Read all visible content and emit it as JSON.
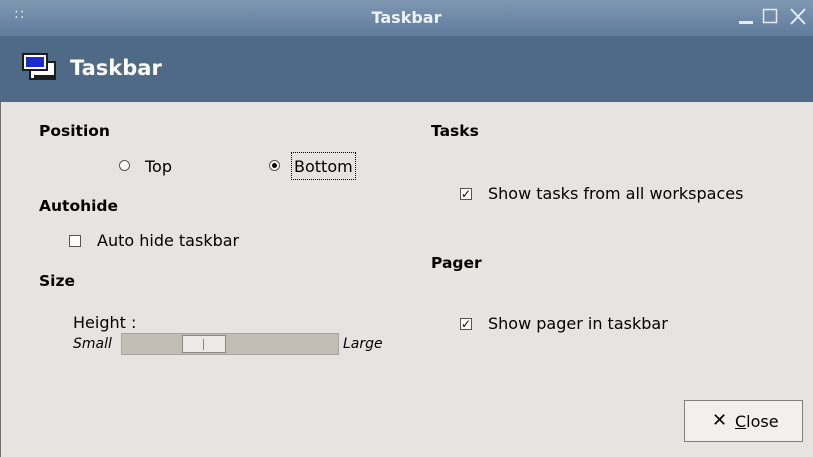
{
  "window": {
    "title": "Taskbar",
    "grip": "::",
    "minimize_icon": "minimize-icon",
    "maximize_icon": "maximize-icon",
    "close_icon": "close-icon"
  },
  "header": {
    "icon": "monitor-icon",
    "title": "Taskbar"
  },
  "position": {
    "heading": "Position",
    "options": [
      {
        "label": "Top",
        "selected": false
      },
      {
        "label": "Bottom",
        "selected": true
      }
    ]
  },
  "autohide": {
    "heading": "Autohide",
    "checkbox_label": "Auto hide taskbar",
    "checked": false
  },
  "size": {
    "heading": "Size",
    "height_label": "Height :",
    "min_label": "Small",
    "max_label": "Large",
    "slider_value_fraction": 0.35
  },
  "tasks": {
    "heading": "Tasks",
    "checkbox_label": "Show tasks from all workspaces",
    "checked": true
  },
  "pager": {
    "heading": "Pager",
    "checkbox_label": "Show pager in taskbar",
    "checked": true
  },
  "buttons": {
    "close_label": "Close",
    "close_icon": "x-icon"
  }
}
